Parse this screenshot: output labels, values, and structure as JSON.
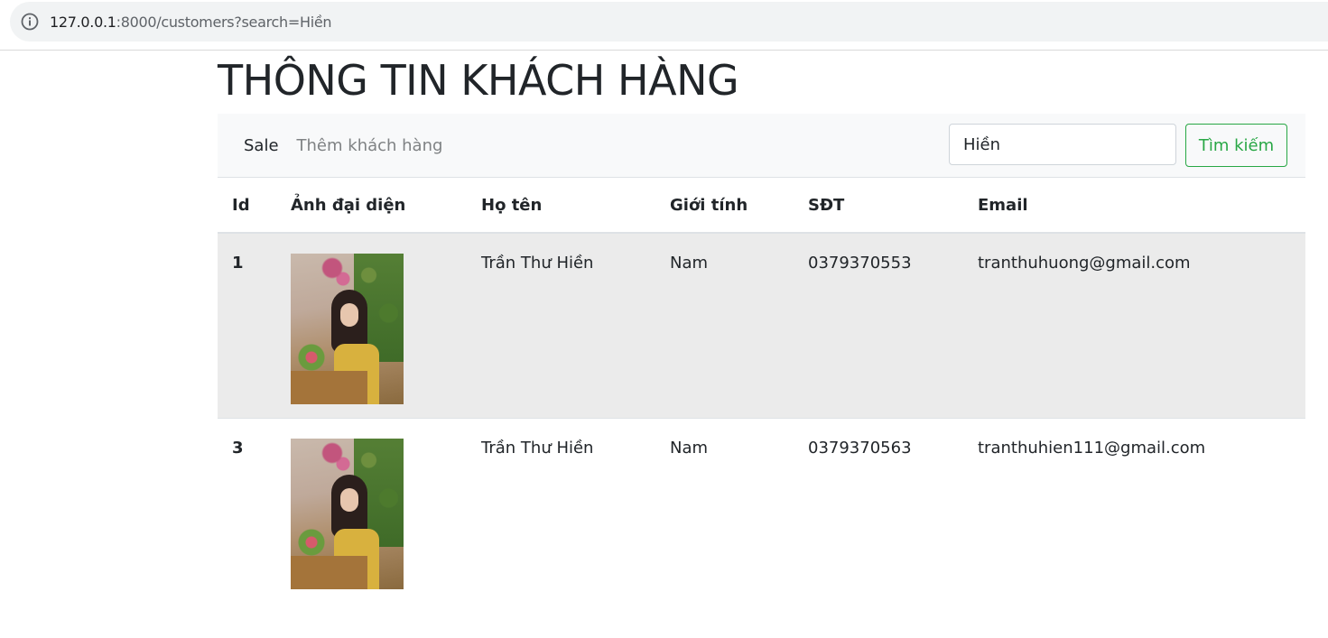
{
  "browser": {
    "url_host": "127.0.0.1",
    "url_rest": ":8000/customers?search=Hiền"
  },
  "page": {
    "title": "THÔNG TIN KHÁCH HÀNG"
  },
  "navbar": {
    "brand": "Sale",
    "add_link": "Thêm khách hàng",
    "search_value": "Hiền",
    "search_button": "Tìm kiếm"
  },
  "table": {
    "headers": {
      "id": "Id",
      "avatar": "Ảnh đại diện",
      "name": "Họ tên",
      "gender": "Giới tính",
      "phone": "SĐT",
      "email": "Email"
    },
    "rows": [
      {
        "id": "1",
        "name": "Trần Thư Hiền",
        "gender": "Nam",
        "phone": "0379370553",
        "email": "tranthuhuong@gmail.com"
      },
      {
        "id": "3",
        "name": "Trần Thư Hiền",
        "gender": "Nam",
        "phone": "0379370563",
        "email": "tranthuhien111@gmail.com"
      }
    ]
  }
}
